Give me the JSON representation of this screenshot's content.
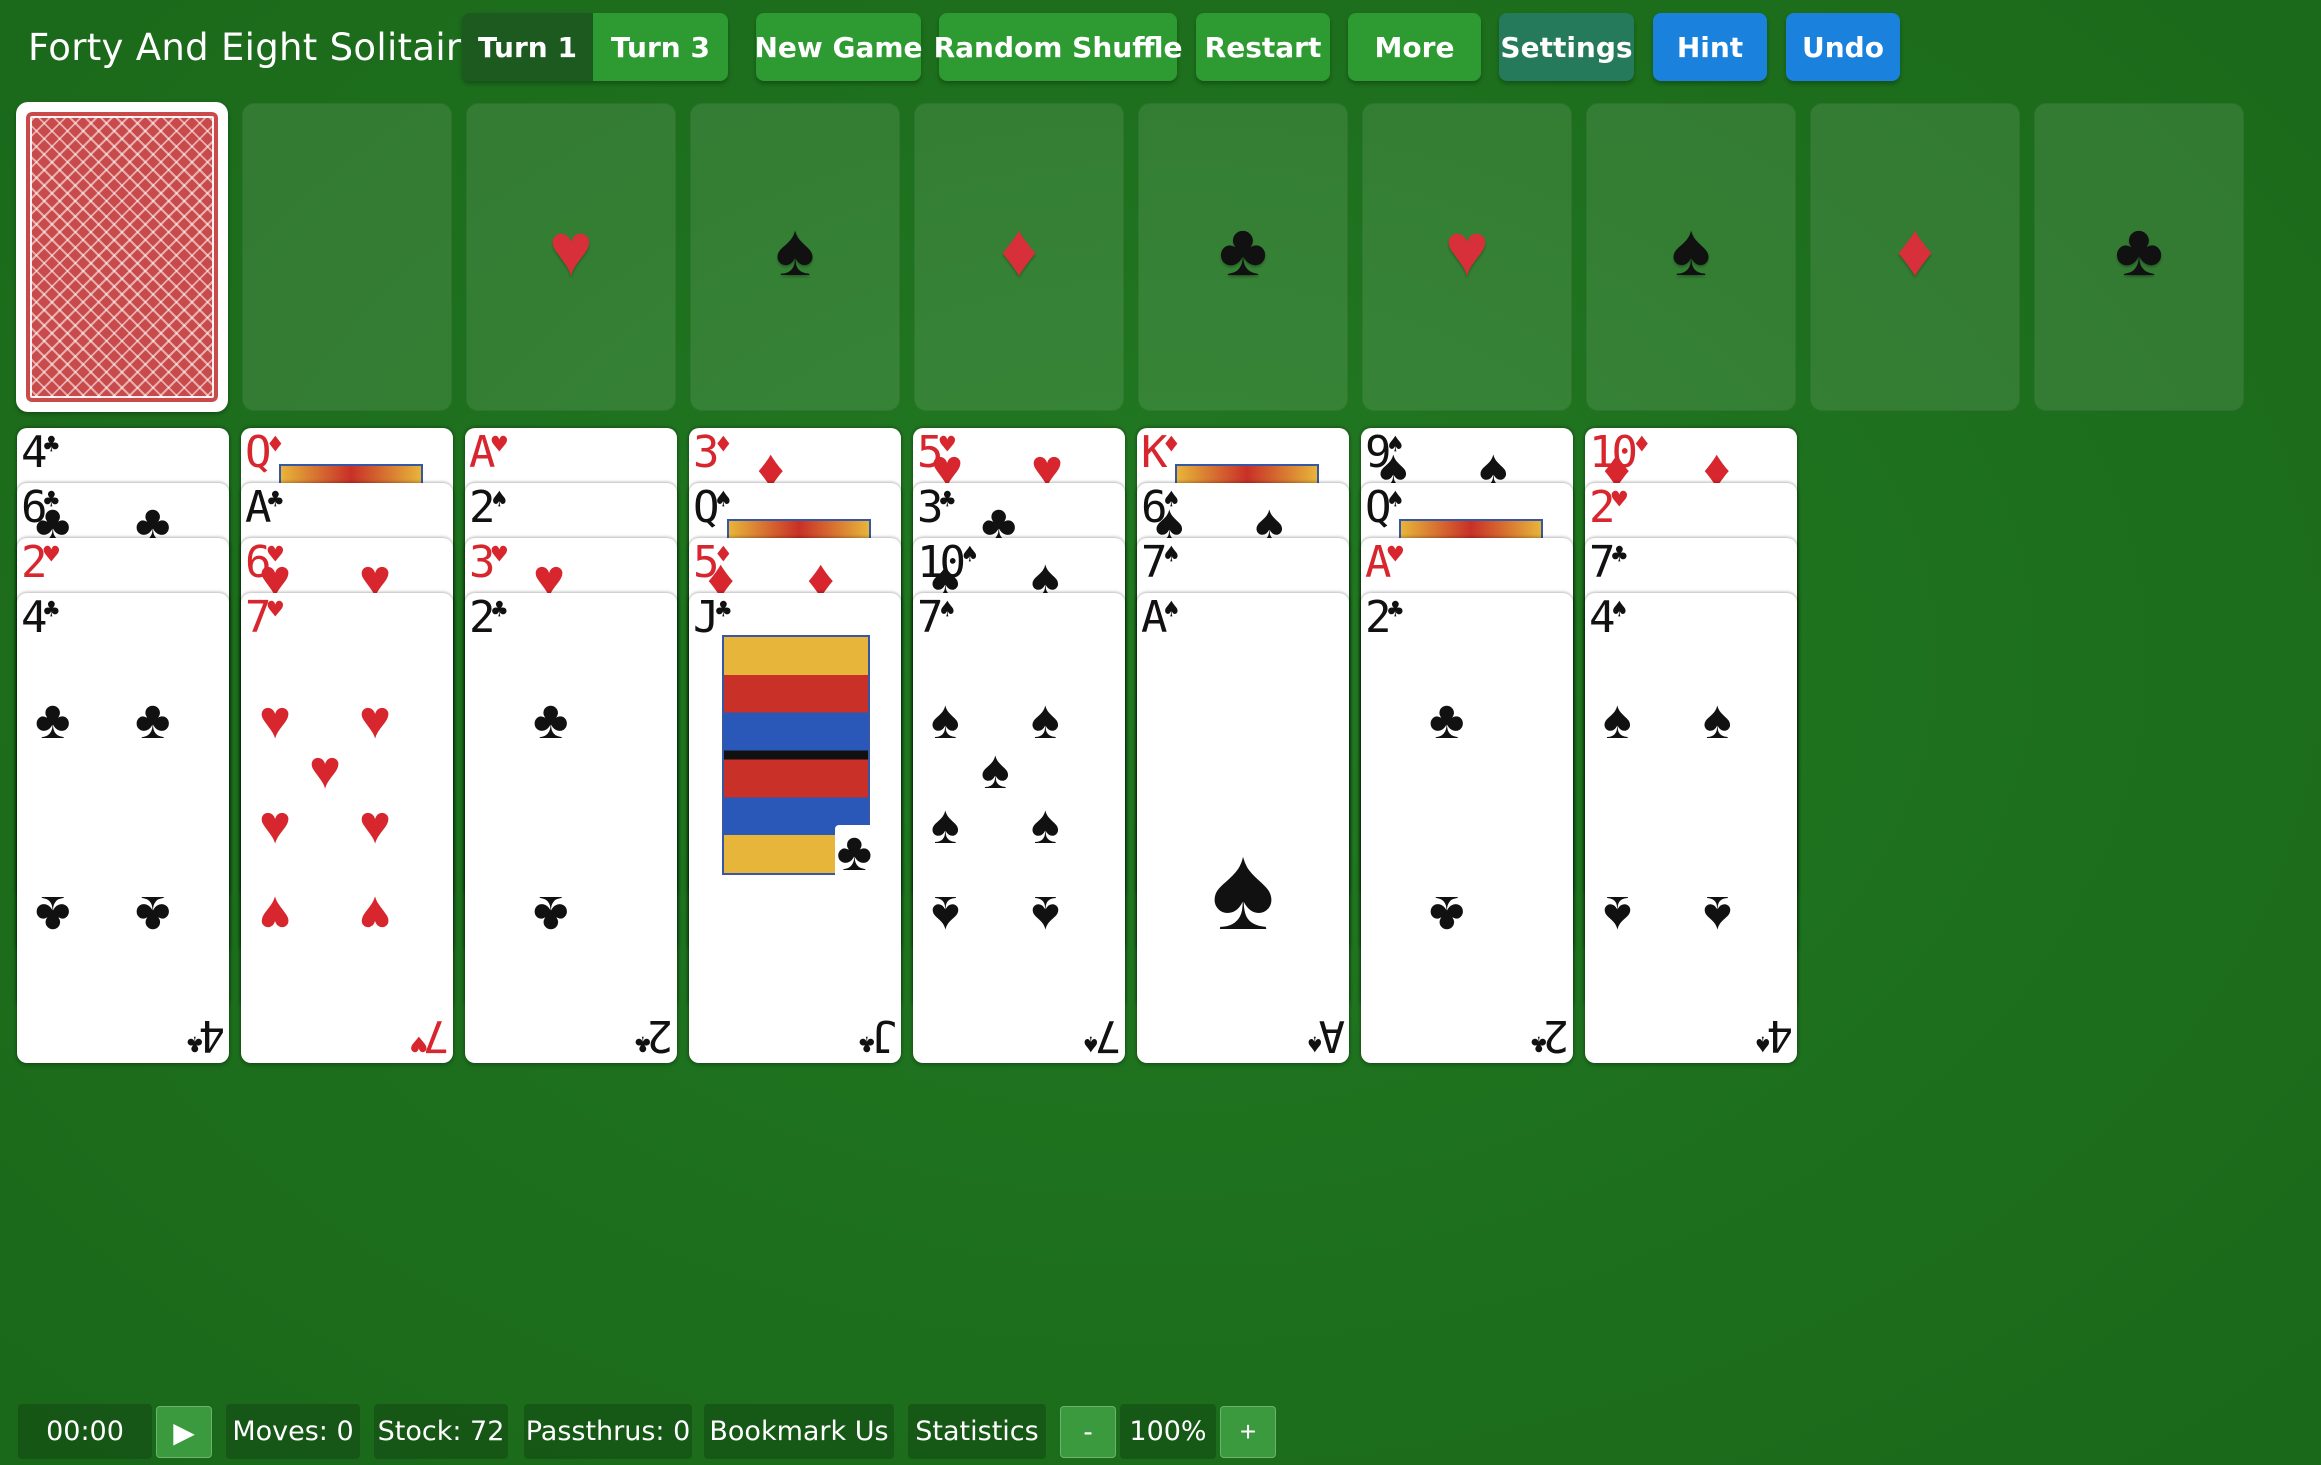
{
  "title": "Forty And Eight Solitaire",
  "toolbar": {
    "turn1": "Turn 1",
    "turn3": "Turn 3",
    "new_game": "New Game",
    "random_shuffle": "Random Shuffle",
    "restart": "Restart",
    "more": "More",
    "settings": "Settings",
    "hint": "Hint",
    "undo": "Undo"
  },
  "foundations": [
    "♥",
    "♠",
    "♦",
    "♣",
    "♥",
    "♠",
    "♦",
    "♣"
  ],
  "tableau": [
    [
      {
        "r": "4",
        "s": "♣"
      },
      {
        "r": "6",
        "s": "♣"
      },
      {
        "r": "2",
        "s": "♥"
      },
      {
        "r": "4",
        "s": "♣"
      }
    ],
    [
      {
        "r": "Q",
        "s": "♦"
      },
      {
        "r": "A",
        "s": "♣"
      },
      {
        "r": "6",
        "s": "♥"
      },
      {
        "r": "7",
        "s": "♥"
      }
    ],
    [
      {
        "r": "A",
        "s": "♥"
      },
      {
        "r": "2",
        "s": "♠"
      },
      {
        "r": "3",
        "s": "♥"
      },
      {
        "r": "2",
        "s": "♣"
      }
    ],
    [
      {
        "r": "3",
        "s": "♦"
      },
      {
        "r": "Q",
        "s": "♠"
      },
      {
        "r": "5",
        "s": "♦"
      },
      {
        "r": "J",
        "s": "♣"
      }
    ],
    [
      {
        "r": "5",
        "s": "♥"
      },
      {
        "r": "3",
        "s": "♣"
      },
      {
        "r": "10",
        "s": "♠"
      },
      {
        "r": "7",
        "s": "♠"
      }
    ],
    [
      {
        "r": "K",
        "s": "♦"
      },
      {
        "r": "6",
        "s": "♠"
      },
      {
        "r": "7",
        "s": "♠"
      },
      {
        "r": "A",
        "s": "♠"
      }
    ],
    [
      {
        "r": "9",
        "s": "♠"
      },
      {
        "r": "Q",
        "s": "♠"
      },
      {
        "r": "A",
        "s": "♥"
      },
      {
        "r": "2",
        "s": "♣"
      }
    ],
    [
      {
        "r": "10",
        "s": "♦"
      },
      {
        "r": "2",
        "s": "♥"
      },
      {
        "r": "7",
        "s": "♣"
      },
      {
        "r": "4",
        "s": "♠"
      }
    ]
  ],
  "status": {
    "time": "00:00",
    "play_icon": "▶",
    "moves": "Moves: 0",
    "stock": "Stock: 72",
    "passthrus": "Passthrus: 0",
    "bookmark": "Bookmark Us",
    "statistics": "Statistics",
    "zoom_out": "-",
    "zoom": "100%",
    "zoom_in": "+"
  }
}
